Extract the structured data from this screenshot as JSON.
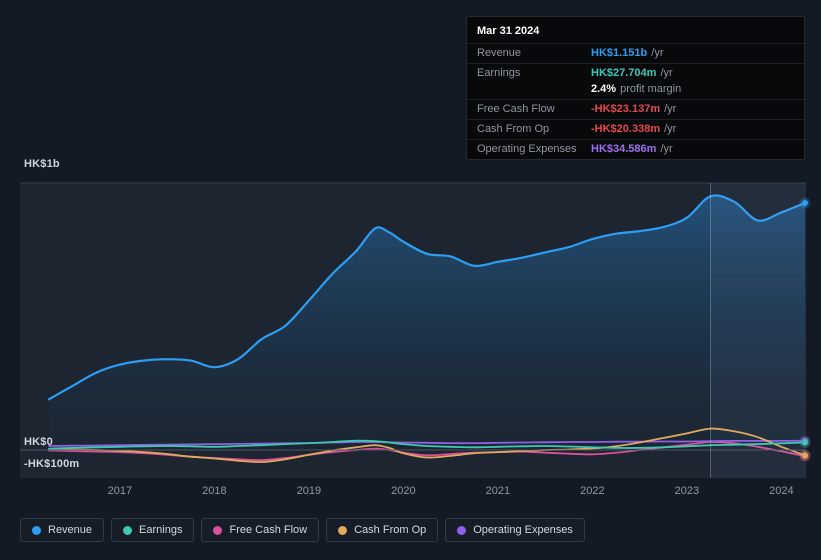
{
  "tooltip": {
    "date": "Mar 31 2024",
    "rows": [
      {
        "label": "Revenue",
        "value": "HK$1.151b",
        "suffix": "/yr",
        "color": "#2e9ef2",
        "divider": true
      },
      {
        "label": "Earnings",
        "value": "HK$27.704m",
        "suffix": "/yr",
        "color": "#3fc7b2",
        "divider": true
      },
      {
        "label": "",
        "value": "2.4%",
        "suffix": "profit margin",
        "color": "#ffffff",
        "divider": false
      },
      {
        "label": "Free Cash Flow",
        "value": "-HK$23.137m",
        "suffix": "/yr",
        "color": "#e5484d",
        "divider": true
      },
      {
        "label": "Cash From Op",
        "value": "-HK$20.338m",
        "suffix": "/yr",
        "color": "#e5484d",
        "divider": true
      },
      {
        "label": "Operating Expenses",
        "value": "HK$34.586m",
        "suffix": "/yr",
        "color": "#9f6ef2",
        "divider": true
      }
    ]
  },
  "axis": {
    "y_top": "HK$1b",
    "y_zero": "HK$0",
    "y_neg": "-HK$100m",
    "x_ticks": [
      "2017",
      "2018",
      "2019",
      "2020",
      "2021",
      "2022",
      "2023",
      "2024"
    ]
  },
  "legend": [
    {
      "label": "Revenue",
      "color": "#2e9ef2"
    },
    {
      "label": "Earnings",
      "color": "#3fc7b2"
    },
    {
      "label": "Free Cash Flow",
      "color": "#d9509c"
    },
    {
      "label": "Cash From Op",
      "color": "#e2a95c"
    },
    {
      "label": "Operating Expenses",
      "color": "#8f5fe8"
    }
  ],
  "chart_data": {
    "type": "area",
    "title": "",
    "units": "HK$ millions per year",
    "x_range": [
      2016.25,
      2024.25
    ],
    "ylim": [
      -105,
      1100
    ],
    "gridlines": [
      1000,
      667,
      333,
      0
    ],
    "marker_x": 2023.25,
    "highlight_from": 2023.25,
    "legend_position": "bottom",
    "x": [
      2016.25,
      2016.5,
      2016.75,
      2017.0,
      2017.25,
      2017.5,
      2017.75,
      2018.0,
      2018.25,
      2018.5,
      2018.75,
      2019.0,
      2019.25,
      2019.5,
      2019.7,
      2019.85,
      2020.0,
      2020.25,
      2020.5,
      2020.75,
      2021.0,
      2021.25,
      2021.5,
      2021.75,
      2022.0,
      2022.25,
      2022.5,
      2022.75,
      2023.0,
      2023.25,
      2023.5,
      2023.75,
      2024.0,
      2024.25
    ],
    "series": [
      {
        "name": "Revenue",
        "color": "#2e9ef2",
        "area": true,
        "width": 2.2,
        "values": [
          190,
          240,
          290,
          320,
          335,
          340,
          335,
          310,
          340,
          415,
          465,
          560,
          660,
          745,
          830,
          815,
          780,
          735,
          725,
          690,
          705,
          720,
          740,
          760,
          790,
          810,
          820,
          835,
          870,
          950,
          930,
          860,
          890,
          925
        ]
      },
      {
        "name": "Earnings",
        "color": "#3fc7b2",
        "area": false,
        "width": 1.8,
        "values": [
          5,
          8,
          10,
          12,
          14,
          15,
          14,
          12,
          15,
          18,
          22,
          26,
          30,
          35,
          33,
          28,
          22,
          15,
          12,
          10,
          12,
          14,
          15,
          13,
          10,
          8,
          8,
          10,
          14,
          18,
          20,
          22,
          25,
          28
        ]
      },
      {
        "name": "Free Cash Flow",
        "color": "#d9509c",
        "area": false,
        "width": 1.8,
        "values": [
          -2,
          -4,
          -6,
          -8,
          -12,
          -18,
          -25,
          -30,
          -35,
          -38,
          -30,
          -18,
          -8,
          0,
          5,
          0,
          -10,
          -20,
          -15,
          -10,
          -8,
          -6,
          -10,
          -14,
          -16,
          -10,
          0,
          10,
          20,
          30,
          25,
          12,
          -5,
          -23
        ]
      },
      {
        "name": "Cash From Op",
        "color": "#e2a95c",
        "area": false,
        "width": 1.8,
        "values": [
          3,
          2,
          0,
          -3,
          -8,
          -15,
          -25,
          -32,
          -40,
          -45,
          -35,
          -18,
          -2,
          10,
          18,
          8,
          -12,
          -28,
          -22,
          -12,
          -8,
          -4,
          0,
          2,
          6,
          14,
          28,
          45,
          62,
          80,
          70,
          48,
          12,
          -20
        ]
      },
      {
        "name": "Operating Expenses",
        "color": "#8f5fe8",
        "area": false,
        "width": 1.8,
        "values": [
          15,
          16,
          17,
          18,
          19,
          20,
          21,
          22,
          23,
          24,
          25,
          26,
          28,
          30,
          30,
          29,
          28,
          27,
          26,
          26,
          27,
          28,
          29,
          30,
          30,
          31,
          31,
          32,
          32,
          33,
          34,
          34,
          34,
          35
        ]
      }
    ]
  }
}
